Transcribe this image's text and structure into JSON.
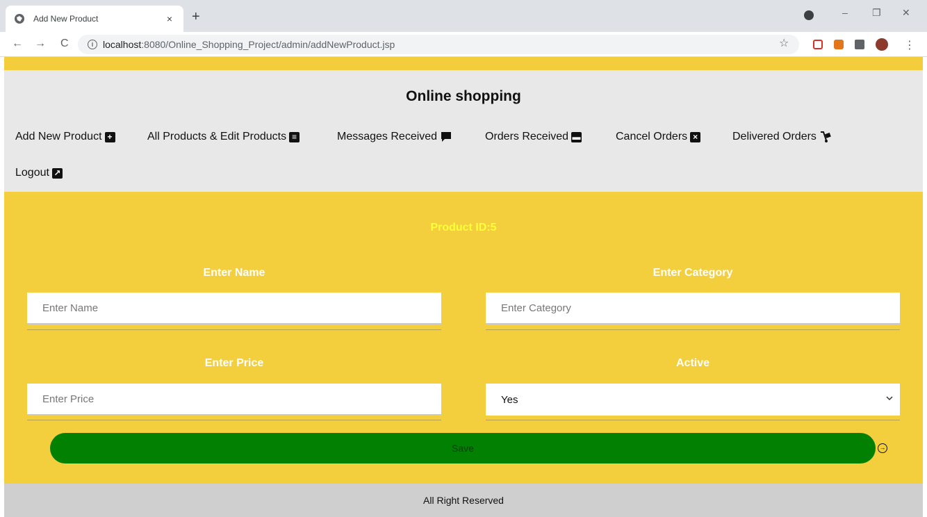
{
  "browser": {
    "tab_title": "Add New Product",
    "tab_close": "×",
    "new_tab": "+",
    "url_host": "localhost",
    "url_rest": ":8080/Online_Shopping_Project/admin/addNewProduct.jsp",
    "controls": {
      "minimize": "–",
      "restore": "❐",
      "close": "✕"
    },
    "nav": {
      "back": "←",
      "forward": "→",
      "reload": "C"
    },
    "star": "☆",
    "menu": "⋮"
  },
  "header": {
    "title": "Online shopping",
    "nav": [
      {
        "label": "Add New Product",
        "icon": "plus-square-icon",
        "glyph": "+"
      },
      {
        "label": "All Products & Edit Products",
        "icon": "list-icon",
        "glyph": "≡"
      },
      {
        "label": "Messages Received",
        "icon": "comment-icon",
        "glyph": ""
      },
      {
        "label": "Orders Received",
        "icon": "archive-icon",
        "glyph": "▬"
      },
      {
        "label": "Cancel Orders",
        "icon": "close-square-icon",
        "glyph": "×"
      },
      {
        "label": "Delivered Orders",
        "icon": "dolly-icon",
        "glyph": ""
      },
      {
        "label": "Logout",
        "icon": "share-square-icon",
        "glyph": "↗"
      }
    ]
  },
  "form": {
    "product_id": "Product ID:5",
    "name_label": "Enter Name",
    "name_placeholder": "Enter Name",
    "category_label": "Enter Category",
    "category_placeholder": "Enter Category",
    "price_label": "Enter Price",
    "price_placeholder": "Enter Price",
    "active_label": "Active",
    "active_value": "Yes",
    "save_label": "Save"
  },
  "footer": {
    "text": "All Right Reserved"
  },
  "colors": {
    "accent_yellow": "#f3cf3d",
    "save_green": "#018001",
    "header_gray": "#e8e8e8",
    "footer_gray": "#cfcfcf",
    "product_id_yellow": "#ffff3a"
  }
}
